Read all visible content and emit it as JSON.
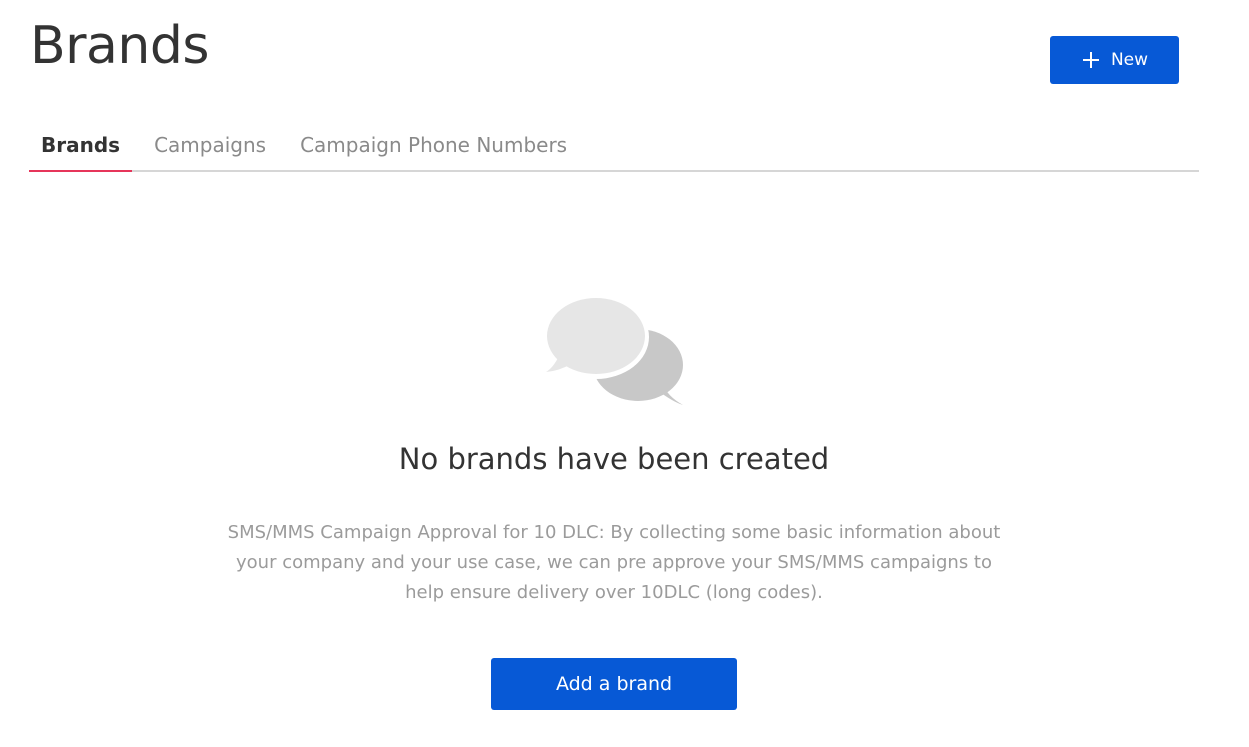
{
  "header": {
    "title": "Brands",
    "new_button_label": "New",
    "new_button_icon": "plus-icon"
  },
  "tabs": [
    {
      "label": "Brands",
      "active": true
    },
    {
      "label": "Campaigns",
      "active": false
    },
    {
      "label": "Campaign Phone Numbers",
      "active": false
    }
  ],
  "empty_state": {
    "icon": "chat-bubbles-icon",
    "heading": "No brands have been created",
    "description": "SMS/MMS Campaign Approval for 10 DLC: By collecting some basic information about your company and your use case, we can pre approve your SMS/MMS campaigns to help ensure delivery over 10DLC (long codes).",
    "button_label": "Add a brand"
  },
  "colors": {
    "primary_button": "#0759d6",
    "active_tab_indicator": "#e6355a",
    "tab_divider": "#d6d6d6",
    "muted_text": "#9b9b9b",
    "text": "#333333"
  }
}
